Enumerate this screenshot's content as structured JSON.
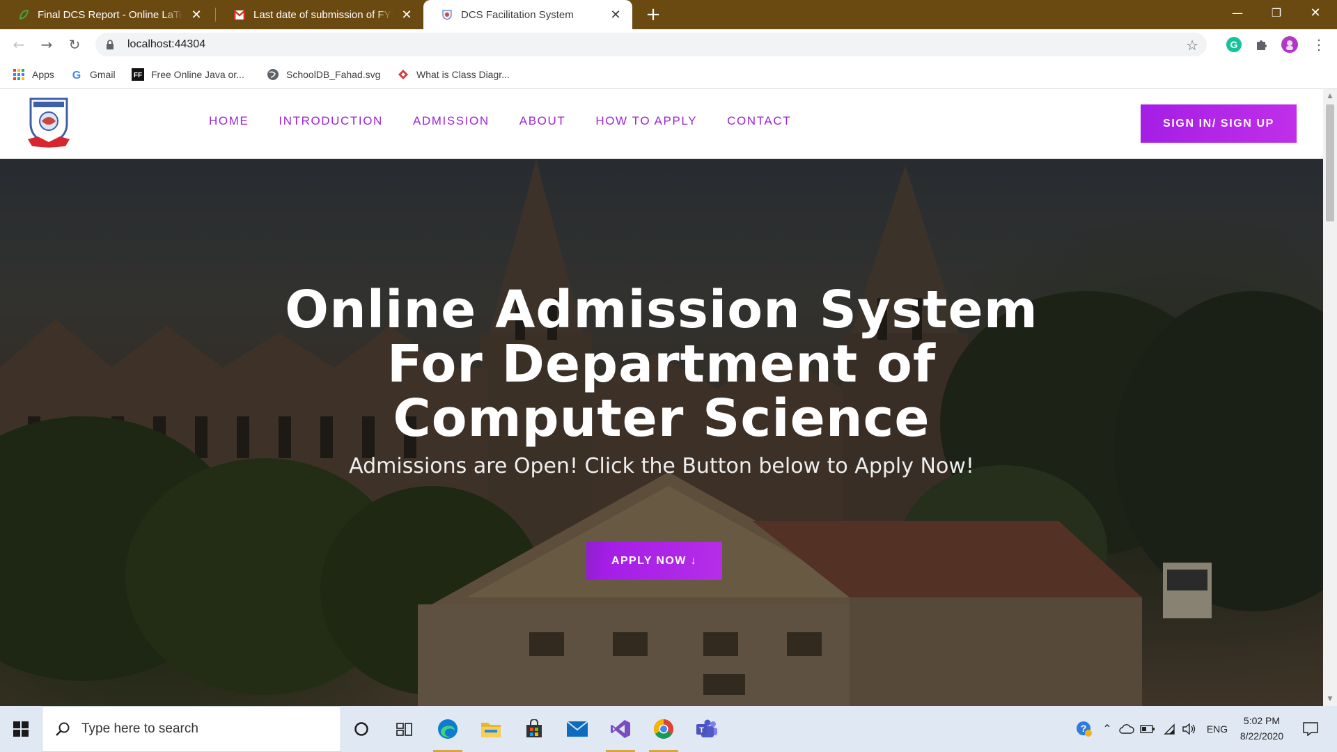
{
  "browser": {
    "tabs": [
      {
        "title": "Final DCS Report - Online LaTeX Editor",
        "favicon": "overleaf-leaf-icon",
        "close": "✕"
      },
      {
        "title": "Last date of submission of FYP for",
        "favicon": "gmail-icon",
        "close": "✕"
      },
      {
        "title": "DCS Facilitation System",
        "favicon": "site-favicon",
        "close": "✕",
        "active": true
      }
    ],
    "new_tab": "+",
    "window_controls": {
      "minimize": "—",
      "restore": "❐",
      "close": "✕"
    },
    "nav": {
      "back": "←",
      "forward": "→",
      "reload": "↻"
    },
    "url": "localhost:44304",
    "star": "☆",
    "bookmarks": [
      {
        "label": "Apps",
        "icon": "apps-grid-icon"
      },
      {
        "label": "Gmail",
        "icon": "google-g-icon"
      },
      {
        "label": "Free Online Java or...",
        "icon": "ff-icon"
      },
      {
        "label": "SchoolDB_Fahad.svg",
        "icon": "globe-icon"
      },
      {
        "label": "What is Class Diagr...",
        "icon": "diamond-icon"
      }
    ]
  },
  "site": {
    "nav": [
      "HOME",
      "INTRODUCTION",
      "ADMISSION",
      "ABOUT",
      "HOW TO APPLY",
      "CONTACT"
    ],
    "signin": "SIGN IN/ SIGN UP",
    "hero": {
      "title_lines": [
        "Online Admission System",
        "For Department of",
        "Computer Science"
      ],
      "subtitle": "Admissions are Open! Click the Button below to Apply Now!",
      "button": "APPLY NOW ↓"
    },
    "colors": {
      "accent": "#a51ee6",
      "nav_text": "#9b24d8"
    }
  },
  "taskbar": {
    "search_placeholder": "Type here to search",
    "apps": [
      "cortana-icon",
      "task-view-icon",
      "edge-icon",
      "file-explorer-icon",
      "store-icon",
      "mail-icon",
      "visual-studio-icon",
      "chrome-icon",
      "teams-icon"
    ],
    "tray": {
      "language": "ENG"
    },
    "clock": {
      "time": "5:02 PM",
      "date": "8/22/2020"
    }
  }
}
